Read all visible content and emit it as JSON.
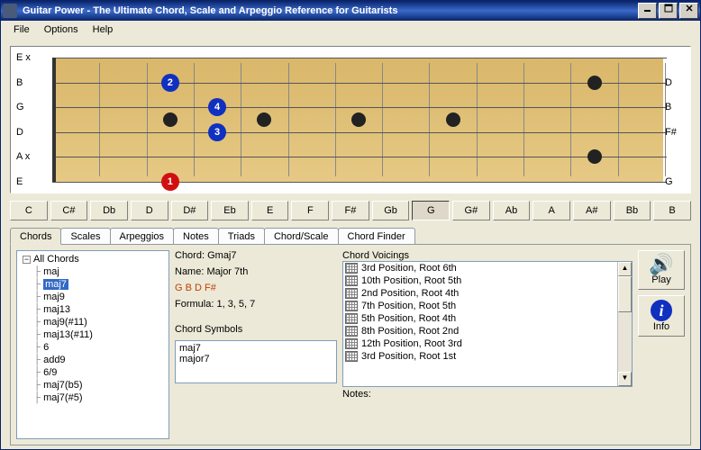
{
  "title": "Guitar Power - The Ultimate Chord, Scale and Arpeggio Reference for Guitarists",
  "menu": {
    "file": "File",
    "options": "Options",
    "help": "Help"
  },
  "strings_left": [
    "E",
    "B",
    "G",
    "D",
    "A",
    "E"
  ],
  "strings_right": [
    "D",
    "B",
    "F#",
    "G"
  ],
  "muted": {
    "s1": "x",
    "s5": "x"
  },
  "keys": [
    "C",
    "C#",
    "Db",
    "D",
    "D#",
    "Eb",
    "E",
    "F",
    "F#",
    "Gb",
    "G",
    "G#",
    "Ab",
    "A",
    "A#",
    "Bb",
    "B"
  ],
  "active_key_index": 10,
  "tabs": [
    "Chords",
    "Scales",
    "Arpeggios",
    "Notes",
    "Triads",
    "Chord/Scale",
    "Chord Finder"
  ],
  "active_tab_index": 0,
  "tree": {
    "root": "All Chords",
    "items": [
      "maj",
      "maj7",
      "maj9",
      "maj13",
      "maj9(#11)",
      "maj13(#11)",
      "6",
      "add9",
      "6/9",
      "maj7(b5)",
      "maj7(#5)"
    ],
    "selected_index": 1
  },
  "info": {
    "chord_label": "Chord:",
    "chord_value": "Gmaj7",
    "name_label": "Name:",
    "name_value": "Major 7th",
    "notes_value": "G B D F#",
    "formula_label": "Formula:",
    "formula_value": "1, 3, 5, 7",
    "symbols_label": "Chord Symbols",
    "symbols": [
      "maj7",
      "major7"
    ]
  },
  "voicings": {
    "label": "Chord Voicings",
    "items": [
      "3rd Position, Root 6th",
      "10th Position, Root 5th",
      "2nd Position, Root 4th",
      "7th Position, Root 5th",
      "5th Position, Root 4th",
      "8th Position, Root 2nd",
      "12th Position, Root 3rd",
      "3rd Position, Root 1st"
    ],
    "notes_label": "Notes:"
  },
  "buttons": {
    "play": "Play",
    "info": "Info"
  },
  "fingers": [
    {
      "string": 6,
      "fret": 3,
      "num": "1",
      "color": "red"
    },
    {
      "string": 2,
      "fret": 3,
      "num": "2",
      "color": "blue"
    },
    {
      "string": 4,
      "fret": 4,
      "num": "3",
      "color": "blue"
    },
    {
      "string": 3,
      "fret": 4,
      "num": "4",
      "color": "blue"
    }
  ],
  "fret_markers": [
    {
      "fret": 3,
      "pos": "mid"
    },
    {
      "fret": 5,
      "pos": "mid"
    },
    {
      "fret": 7,
      "pos": "mid"
    },
    {
      "fret": 9,
      "pos": "mid"
    },
    {
      "fret": 12,
      "pos": "double"
    }
  ],
  "num_frets": 13
}
